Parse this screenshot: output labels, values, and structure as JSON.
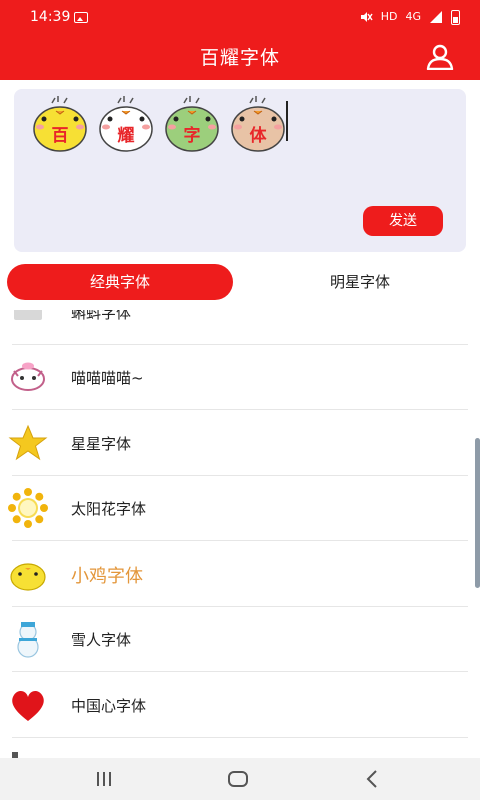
{
  "status_bar": {
    "time": "14:39",
    "network_label": "HD",
    "signal_label": "4G",
    "icons": [
      "image-icon",
      "mute-icon",
      "signal-icon",
      "battery-icon"
    ]
  },
  "header": {
    "title": "百耀字体",
    "user_icon": "user-icon"
  },
  "editor": {
    "emoji_text": [
      "百",
      "耀",
      "字",
      "体"
    ],
    "emoji_colors": [
      "#f7e034",
      "#ffffff",
      "#9ccf7c",
      "#e8c3a6"
    ],
    "send_label": "发送"
  },
  "tabs": [
    {
      "label": "经典字体",
      "active": true
    },
    {
      "label": "明星字体",
      "active": false
    }
  ],
  "font_list": {
    "partial_item_label": "蝌蚪字体",
    "items": [
      {
        "label": "喵喵喵喵~",
        "icon": "cat-face-icon"
      },
      {
        "label": "星星字体",
        "icon": "star-icon"
      },
      {
        "label": "太阳花字体",
        "icon": "sunflower-icon"
      },
      {
        "label": "小鸡字体",
        "icon": "chick-icon",
        "highlight": true
      },
      {
        "label": "雪人字体",
        "icon": "snowman-icon"
      },
      {
        "label": "中国心字体",
        "icon": "heart-icon"
      }
    ]
  },
  "nav_bar": {
    "buttons": [
      "recent-apps",
      "home",
      "back"
    ]
  },
  "colors": {
    "brand_red": "#ee1c1c",
    "editor_bg": "#ececf7",
    "highlight_orange": "#e3963a"
  }
}
